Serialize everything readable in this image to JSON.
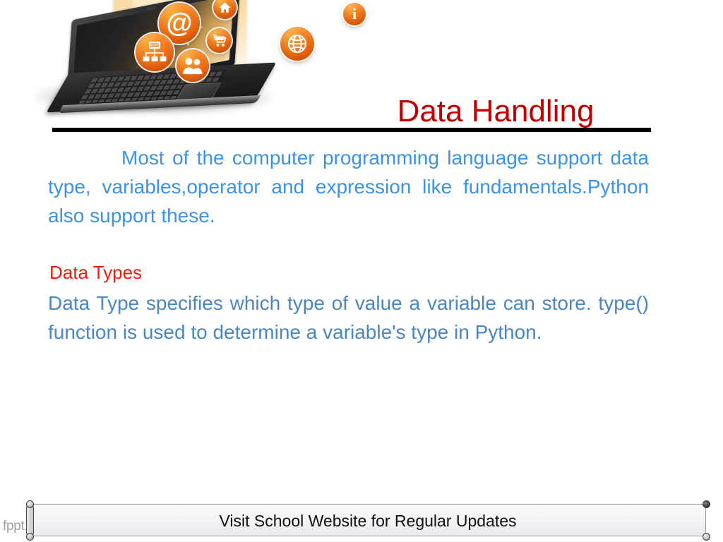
{
  "slide": {
    "title": "Data Handling",
    "paragraph1": "Most of the computer programming language support data type, variables,operator and expression like fundamentals.Python also support these.",
    "heading2": "Data Types",
    "paragraph2": "Data Type specifies which type of value a variable can store. type() function is used to determine a variable's type in Python."
  },
  "footer": {
    "text": "Visit School Website for Regular Updates"
  },
  "watermark": {
    "text": "fppt.c",
    "dots": "..."
  },
  "hero": {
    "alt": "laptop with orange web service icons",
    "icons": [
      {
        "name": "email-at-icon",
        "glyph": "@"
      },
      {
        "name": "home-icon",
        "glyph": "home"
      },
      {
        "name": "shopping-cart-icon",
        "glyph": "cart"
      },
      {
        "name": "sitemap-icon",
        "glyph": "sitemap"
      },
      {
        "name": "users-icon",
        "glyph": "users"
      },
      {
        "name": "globe-icon",
        "glyph": "globe"
      },
      {
        "name": "info-icon",
        "glyph": "i"
      }
    ]
  },
  "colors": {
    "title_red": "#c00000",
    "heading_red": "#ef1c0c",
    "body_blue": "#3d92e3",
    "body_blue_muted": "#4a86c0",
    "rule_black": "#000000",
    "icon_orange": "#f58220",
    "watermark_gray": "#9aa0a6"
  }
}
